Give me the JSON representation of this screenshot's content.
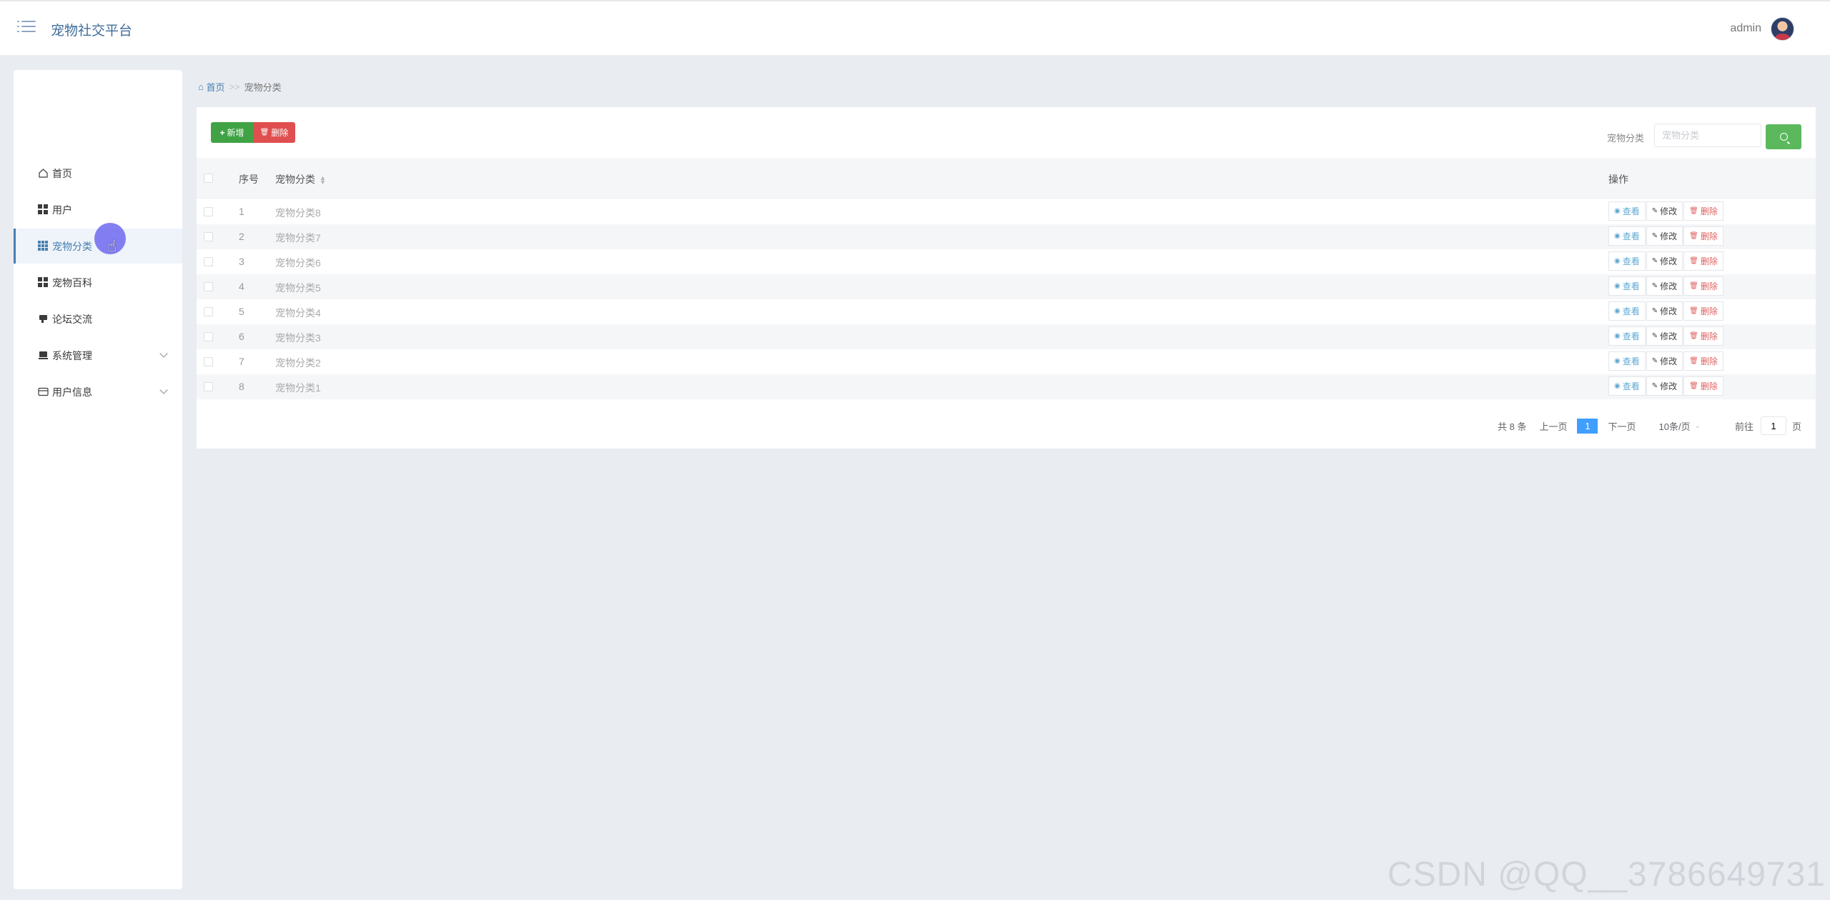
{
  "header": {
    "app_title": "宠物社交平台",
    "username": "admin"
  },
  "sidebar": {
    "items": [
      {
        "label": "首页",
        "icon": "home-icon"
      },
      {
        "label": "用户",
        "icon": "grid-icon"
      },
      {
        "label": "宠物分类",
        "icon": "apps-icon",
        "active": true
      },
      {
        "label": "宠物百科",
        "icon": "grid-icon"
      },
      {
        "label": "论坛交流",
        "icon": "forum-icon"
      },
      {
        "label": "系统管理",
        "icon": "system-icon",
        "expandable": true
      },
      {
        "label": "用户信息",
        "icon": "card-icon",
        "expandable": true
      }
    ]
  },
  "breadcrumb": {
    "home": "首页",
    "separator": ">>",
    "current": "宠物分类"
  },
  "toolbar": {
    "add_label": "新增",
    "delete_label": "删除"
  },
  "search": {
    "label": "宠物分类",
    "placeholder": "宠物分类"
  },
  "table": {
    "columns": {
      "index": "序号",
      "category": "宠物分类",
      "actions": "操作"
    },
    "rows": [
      {
        "index": "1",
        "category": "宠物分类8"
      },
      {
        "index": "2",
        "category": "宠物分类7"
      },
      {
        "index": "3",
        "category": "宠物分类6"
      },
      {
        "index": "4",
        "category": "宠物分类5"
      },
      {
        "index": "5",
        "category": "宠物分类4"
      },
      {
        "index": "6",
        "category": "宠物分类3"
      },
      {
        "index": "7",
        "category": "宠物分类2"
      },
      {
        "index": "8",
        "category": "宠物分类1"
      }
    ],
    "actions": {
      "view": "查看",
      "edit": "修改",
      "delete": "删除"
    }
  },
  "pagination": {
    "total": "共 8 条",
    "prev": "上一页",
    "current_page": "1",
    "next": "下一页",
    "page_size": "10条/页",
    "goto_label": "前往",
    "goto_value": "1",
    "page_suffix": "页"
  },
  "watermark": "CSDN @QQ__3786649731",
  "colors": {
    "primary": "#4a7fb0",
    "add": "#3fa345",
    "delete": "#e04f4f",
    "search": "#5cb85c",
    "page_active": "#409eff"
  }
}
